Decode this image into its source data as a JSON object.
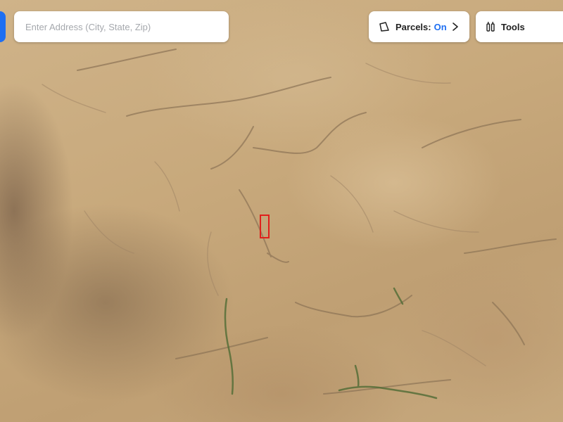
{
  "search": {
    "placeholder": "Enter Address (City, State, Zip)"
  },
  "parcels_toggle": {
    "label": "Parcels:",
    "state": "On",
    "state_color": "#1e6ff2",
    "icon": "parcel-shape-icon"
  },
  "tools_menu": {
    "label": "Tools",
    "icon": "tools-icon"
  },
  "map": {
    "type": "satellite",
    "highlight_color": "#e0201c"
  }
}
